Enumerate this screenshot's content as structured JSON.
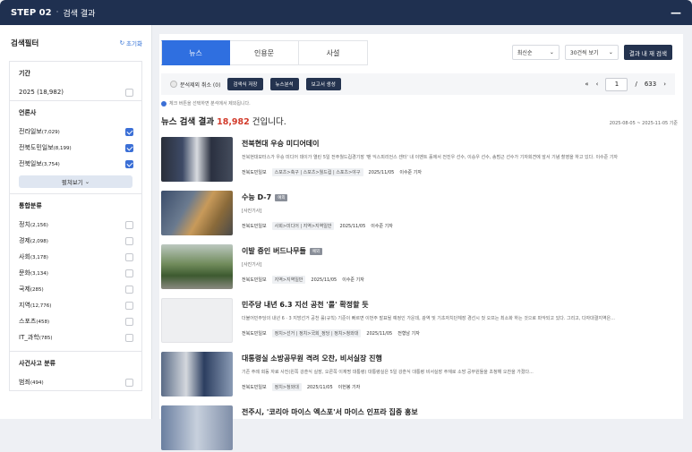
{
  "header": {
    "step": "STEP 02",
    "sep": "·",
    "title": "검색 결과",
    "minimize": "—"
  },
  "sidebar": {
    "title": "검색필터",
    "reset": "초기화",
    "period": {
      "label": "기간",
      "items": [
        {
          "label": "2025",
          "count": "(18,982)",
          "checked": false
        }
      ]
    },
    "press": {
      "label": "언론사",
      "items": [
        {
          "label": "전라일보",
          "count": "(7,029)",
          "checked": true
        },
        {
          "label": "전북도민일보",
          "count": "(8,199)",
          "checked": true
        },
        {
          "label": "전북일보",
          "count": "(3,754)",
          "checked": true
        }
      ],
      "more": "펼쳐보기"
    },
    "category": {
      "label": "통합분류",
      "items": [
        {
          "label": "정치",
          "count": "(2,156)"
        },
        {
          "label": "경제",
          "count": "(2,098)"
        },
        {
          "label": "사회",
          "count": "(3,178)"
        },
        {
          "label": "문화",
          "count": "(3,134)"
        },
        {
          "label": "국제",
          "count": "(285)"
        },
        {
          "label": "지역",
          "count": "(12,776)"
        },
        {
          "label": "스포츠",
          "count": "(458)"
        },
        {
          "label": "IT_과학",
          "count": "(785)"
        }
      ]
    },
    "incident": {
      "label": "사건사고 분류",
      "items": [
        {
          "label": "범죄",
          "count": "(494)"
        }
      ]
    }
  },
  "tabs": [
    "뉴스",
    "인용문",
    "사설"
  ],
  "controls": {
    "sort": "최신순",
    "view": "30건씩 보기",
    "search_in": "결과 내 재 검색"
  },
  "toolbar": {
    "exclude": "분석제외 취소 (0)",
    "save": "검색식 저장",
    "analyze": "뉴스분석",
    "report": "보고서 생성"
  },
  "pager": {
    "current": "1",
    "total": "633",
    "sep": "/"
  },
  "note": "체크 버튼을 선택하면 분석에서 제외됩니다.",
  "results": {
    "prefix": "뉴스 검색 결과",
    "count": "18,982",
    "suffix": "건입니다.",
    "range": "2025-08-05 ~ 2025-11-05 기준"
  },
  "items": [
    {
      "title": "전북현대 우승 미디어데이",
      "tag": "",
      "desc": "전북현대모터스가 우승 미디어 데이가 열린 5일 전주월드컵경기장 '팬 익스피리언스 센터' 내 이벤트 홀에서 전진우 선수, 이승우 선수, 송범근 선수가 기자회견에 앞서 기념 촬영을 하고 있다. 이수준 기자",
      "press": "전북도민일보",
      "cat": "스포츠>축구 | 스포츠>월드컵 | 스포츠>야구",
      "date": "2025/11/05",
      "writer": "이수준 기자"
    },
    {
      "title": "수능 D-7",
      "tag": "예외",
      "desc": "[사진기사]",
      "press": "전북도민일보",
      "cat": "사회>미디어 | 지역>지역일반",
      "date": "2025/11/05",
      "writer": "이수준 기자"
    },
    {
      "title": "이발 중인 버드나무들",
      "tag": "예외",
      "desc": "[사진기사]",
      "press": "전북도민일보",
      "cat": "지역>지역일반",
      "date": "2025/11/05",
      "writer": "이수준 기자"
    },
    {
      "title": "민주당 내년 6.3 지선 공천 '룰' 확정할 듯",
      "tag": "",
      "desc": "더불어민주당의 내년 6 · 3 지방선거 공천 룰(규칙) 기준이 빠르면 이번주 발표될 예정인 가운데, 광역 및 기초자치단체장 경선시 컷 오프는 최소화 하는 것으로 파악되고 있다. 그리고, 다자대결지역은...",
      "press": "전북도민일보",
      "cat": "정치>선거 | 정치>국회_정당 | 정치>청와대",
      "date": "2025/11/05",
      "writer": "전형남 기자"
    },
    {
      "title": "대통령실 소방공무원 격려 오찬, 비서실장 진행",
      "tag": "",
      "desc": "기존 주례 회동 자료 사진(왼쪽 강훈식 실장, 오른쪽 이재명 대통령)  대통령실은 5일 강훈식 대통령 비서실장 주재로 소방 공무원들을 초청해 오찬을 가졌다...",
      "press": "전북도민일보",
      "cat": "정치>청와대",
      "date": "2025/11/05",
      "writer": "이헌봉 기자"
    },
    {
      "title": "전주시, '코리아 마이스 엑스포'서 마이스 인프라 집중 홍보",
      "tag": "",
      "desc": "",
      "press": "",
      "cat": "",
      "date": "",
      "writer": ""
    }
  ],
  "colors": {
    "header": "#1f3050",
    "accent": "#2f6fe0",
    "count": "#d23b2b"
  }
}
